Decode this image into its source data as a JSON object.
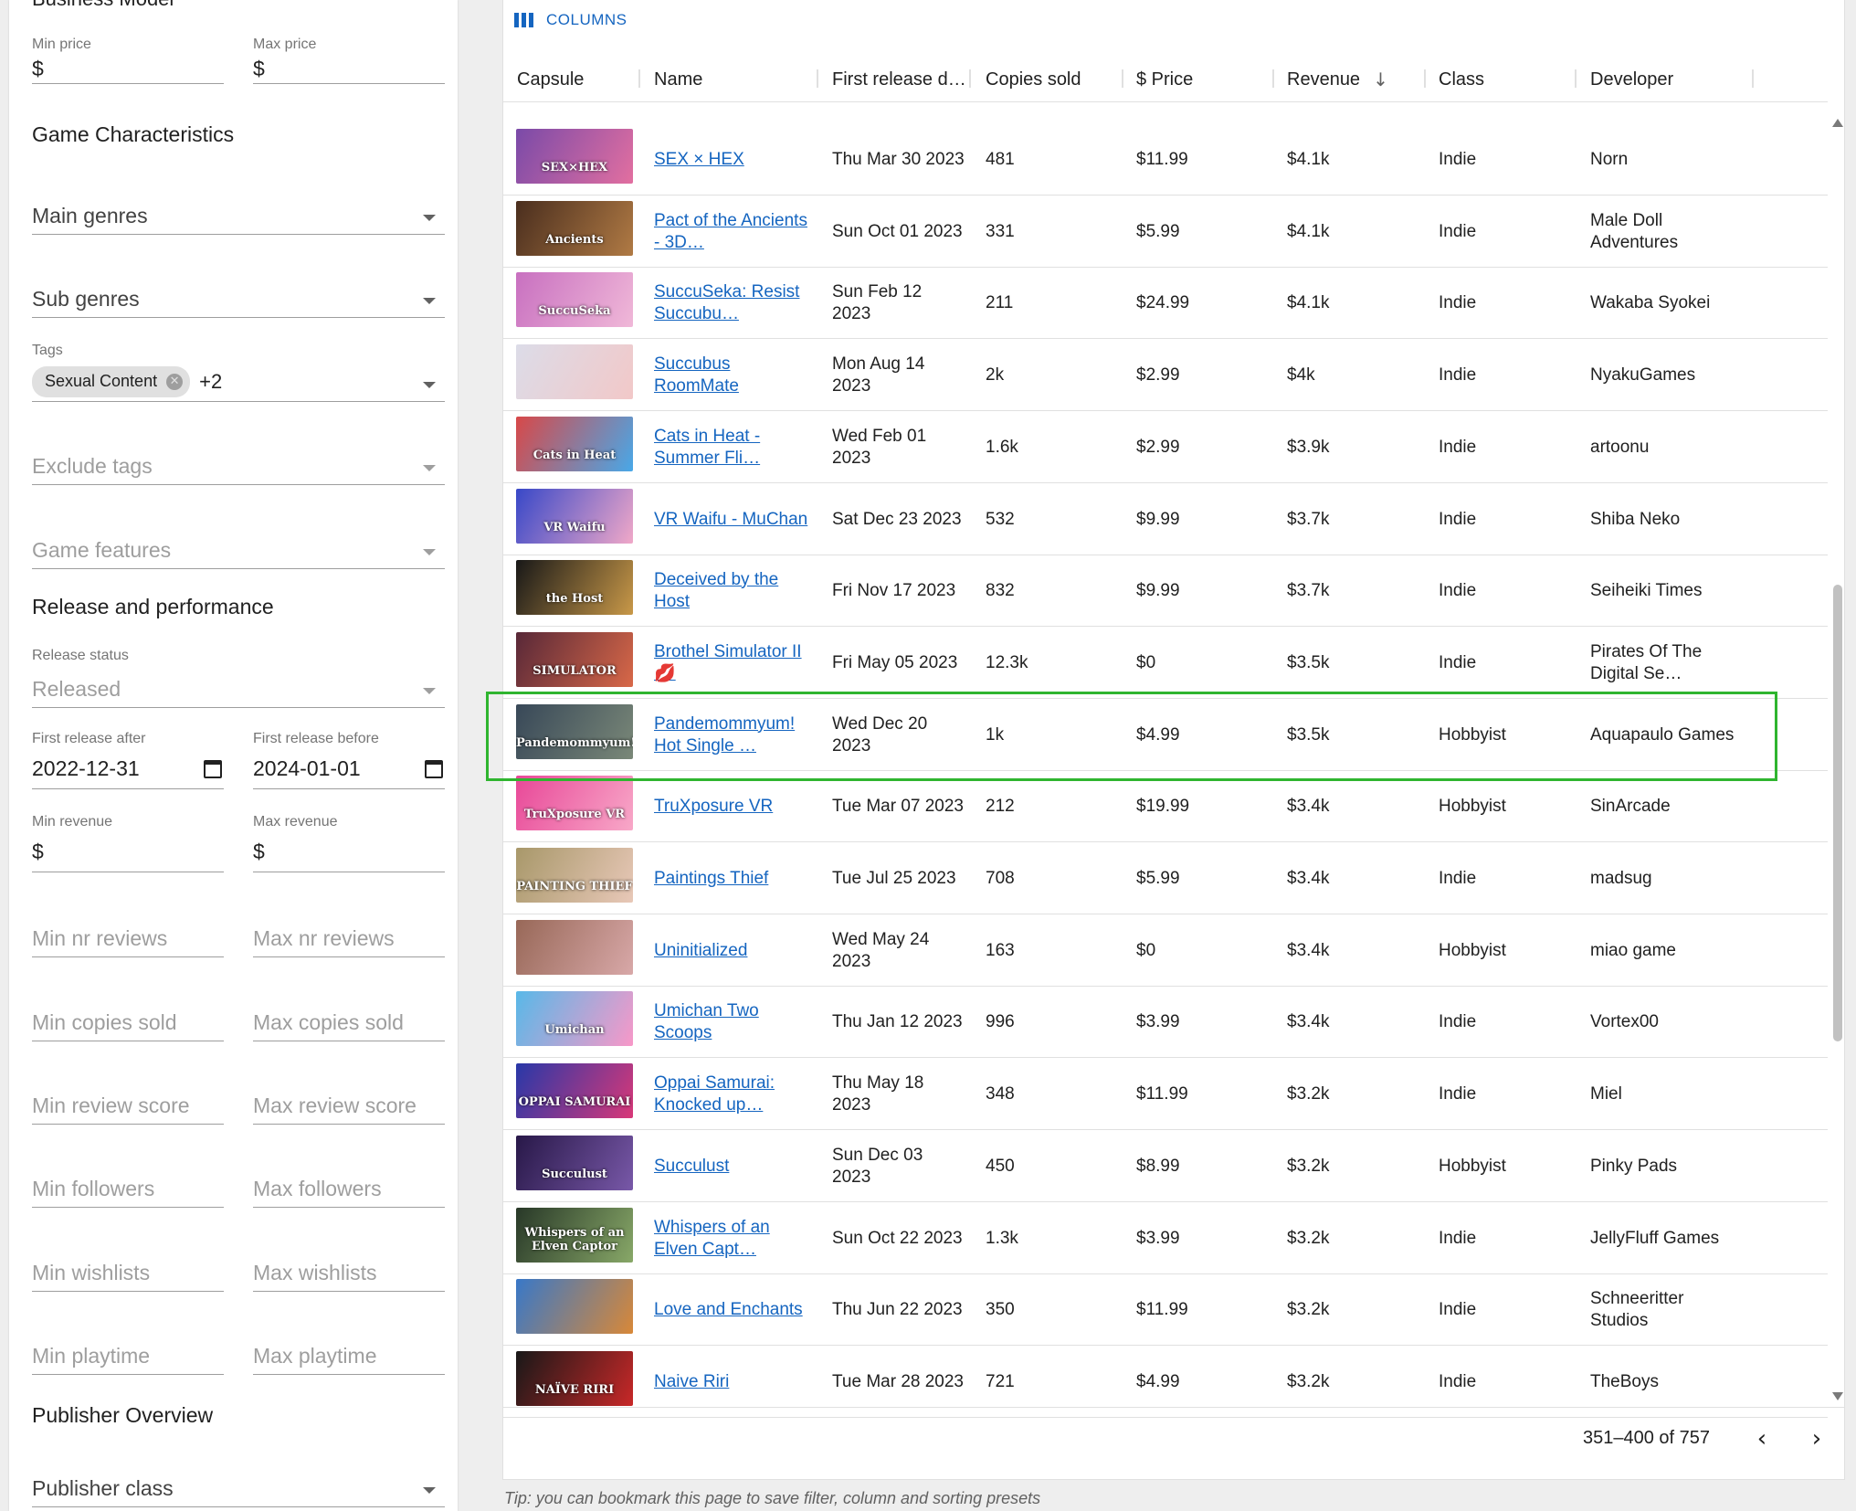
{
  "sidebar": {
    "cut_heading": "Business Model",
    "min_price_label": "Min price",
    "max_price_label": "Max price",
    "currency": "$",
    "game_characteristics": "Game Characteristics",
    "main_genres": "Main genres",
    "sub_genres": "Sub genres",
    "tags_label": "Tags",
    "tag_chip": "Sexual Content",
    "tag_more": "+2",
    "exclude_tags": "Exclude tags",
    "game_features": "Game features",
    "release_performance": "Release and performance",
    "release_status_label": "Release status",
    "release_status_value": "Released",
    "first_release_after_label": "First release after",
    "first_release_after_value": "2022-12-31",
    "first_release_before_label": "First release before",
    "first_release_before_value": "2024-01-01",
    "min_revenue_label": "Min revenue",
    "max_revenue_label": "Max revenue",
    "min_nr_reviews": "Min nr reviews",
    "max_nr_reviews": "Max nr reviews",
    "min_copies_sold": "Min copies sold",
    "max_copies_sold": "Max copies sold",
    "min_review_score": "Min review score",
    "max_review_score": "Max review score",
    "min_followers": "Min followers",
    "max_followers": "Max followers",
    "min_wishlists": "Min wishlists",
    "max_wishlists": "Max wishlists",
    "min_playtime": "Min playtime",
    "max_playtime": "Max playtime",
    "publisher_overview": "Publisher Overview",
    "publisher_class": "Publisher class"
  },
  "grid": {
    "columns_button": "COLUMNS",
    "headers": [
      "Capsule",
      "Name",
      "First release d…",
      "Copies sold",
      "$ Price",
      "Revenue",
      "Class",
      "Developer"
    ],
    "rows": [
      {
        "name": "SEX × HEX",
        "date": "Thu Mar 30 2023",
        "copies": "481",
        "price": "$11.99",
        "revenue": "$4.1k",
        "class": "Indie",
        "developer": "Norn",
        "cap_text": "SEX×HEX",
        "c1": "#7a4aa8",
        "c2": "#e26fa0"
      },
      {
        "name": "Pact of the Ancients - 3D…",
        "date": "Sun Oct 01 2023",
        "copies": "331",
        "price": "$5.99",
        "revenue": "$4.1k",
        "class": "Indie",
        "developer": "Male Doll Adventures",
        "cap_text": "Ancients",
        "c1": "#4a2e1e",
        "c2": "#b07a44"
      },
      {
        "name": "SuccuSeka: Resist Succubu…",
        "date": "Sun Feb 12 2023",
        "copies": "211",
        "price": "$24.99",
        "revenue": "$4.1k",
        "class": "Indie",
        "developer": "Wakaba Syokei",
        "cap_text": "SuccuSeka",
        "c1": "#c870c0",
        "c2": "#f0b8d8"
      },
      {
        "name": "Succubus RoomMate",
        "date": "Mon Aug 14 2023",
        "copies": "2k",
        "price": "$2.99",
        "revenue": "$4k",
        "class": "Indie",
        "developer": "NyakuGames",
        "cap_text": "",
        "c1": "#dcdce8",
        "c2": "#f2c8c8"
      },
      {
        "name": "Cats in Heat - Summer Fli…",
        "date": "Wed Feb 01 2023",
        "copies": "1.6k",
        "price": "$2.99",
        "revenue": "$3.9k",
        "class": "Indie",
        "developer": "artoonu",
        "cap_text": "Cats in Heat",
        "c1": "#d84848",
        "c2": "#48a8e8"
      },
      {
        "name": "VR Waifu - MuChan",
        "date": "Sat Dec 23 2023",
        "copies": "532",
        "price": "$9.99",
        "revenue": "$3.7k",
        "class": "Indie",
        "developer": "Shiba Neko",
        "cap_text": "VR Waifu",
        "c1": "#3848c8",
        "c2": "#f0a8c8"
      },
      {
        "name": "Deceived by the Host",
        "date": "Fri Nov 17 2023",
        "copies": "832",
        "price": "$9.99",
        "revenue": "$3.7k",
        "class": "Indie",
        "developer": "Seiheiki Times",
        "cap_text": "the Host",
        "c1": "#181818",
        "c2": "#c89848"
      },
      {
        "name": "Brothel Simulator II 💋",
        "date": "Fri May 05 2023",
        "copies": "12.3k",
        "price": "$0",
        "revenue": "$3.5k",
        "class": "Indie",
        "developer": "Pirates Of The Digital Se…",
        "cap_text": "SIMULATOR",
        "c1": "#582838",
        "c2": "#d86848"
      },
      {
        "name": "Pandemommyum! Hot Single …",
        "date": "Wed Dec 20 2023",
        "copies": "1k",
        "price": "$4.99",
        "revenue": "$3.5k",
        "class": "Hobbyist",
        "developer": "Aquapaulo Games",
        "cap_text": "Pandemommyum!",
        "c1": "#384858",
        "c2": "#7a8878"
      },
      {
        "name": "TruXposure VR",
        "date": "Tue Mar 07 2023",
        "copies": "212",
        "price": "$19.99",
        "revenue": "$3.4k",
        "class": "Hobbyist",
        "developer": "SinArcade",
        "cap_text": "TruXposure VR",
        "c1": "#e84898",
        "c2": "#f8a8c8"
      },
      {
        "name": "Paintings Thief",
        "date": "Tue Jul 25 2023",
        "copies": "708",
        "price": "$5.99",
        "revenue": "$3.4k",
        "class": "Indie",
        "developer": "madsug",
        "cap_text": "PAINTING THIEF",
        "c1": "#a8986a",
        "c2": "#e8c8b8"
      },
      {
        "name": "Uninitialized",
        "date": "Wed May 24 2023",
        "copies": "163",
        "price": "$0",
        "revenue": "$3.4k",
        "class": "Hobbyist",
        "developer": "miao game",
        "cap_text": "",
        "c1": "#986858",
        "c2": "#d8a8a8"
      },
      {
        "name": "Umichan Two Scoops",
        "date": "Thu Jan 12 2023",
        "copies": "996",
        "price": "$3.99",
        "revenue": "$3.4k",
        "class": "Indie",
        "developer": "Vortex00",
        "cap_text": "Umichan",
        "c1": "#58b8e8",
        "c2": "#f898c8"
      },
      {
        "name": "Oppai Samurai: Knocked up…",
        "date": "Thu May 18 2023",
        "copies": "348",
        "price": "$11.99",
        "revenue": "$3.2k",
        "class": "Indie",
        "developer": "Miel",
        "cap_text": "OPPAI SAMURAI",
        "c1": "#2838a8",
        "c2": "#d83878"
      },
      {
        "name": "Succulust",
        "date": "Sun Dec 03 2023",
        "copies": "450",
        "price": "$8.99",
        "revenue": "$3.2k",
        "class": "Hobbyist",
        "developer": "Pinky Pads",
        "cap_text": "Succulust",
        "c1": "#281848",
        "c2": "#7858a8"
      },
      {
        "name": "Whispers of an Elven Capt…",
        "date": "Sun Oct 22 2023",
        "copies": "1.3k",
        "price": "$3.99",
        "revenue": "$3.2k",
        "class": "Indie",
        "developer": "JellyFluff Games",
        "cap_text": "Whispers of an Elven Captor",
        "c1": "#283828",
        "c2": "#88a868"
      },
      {
        "name": "Love and Enchants",
        "date": "Thu Jun 22 2023",
        "copies": "350",
        "price": "$11.99",
        "revenue": "$3.2k",
        "class": "Indie",
        "developer": "Schneeritter Studios",
        "cap_text": "",
        "c1": "#3878c8",
        "c2": "#d88838"
      },
      {
        "name": "Naive Riri",
        "date": "Tue Mar 28 2023",
        "copies": "721",
        "price": "$4.99",
        "revenue": "$3.2k",
        "class": "Indie",
        "developer": "TheBoys",
        "cap_text": "NAÏVE RIRI",
        "c1": "#181818",
        "c2": "#c82828"
      }
    ],
    "pager_text": "351–400 of 757",
    "tip": "Tip: you can bookmark this page to save filter, column and sorting presets"
  }
}
